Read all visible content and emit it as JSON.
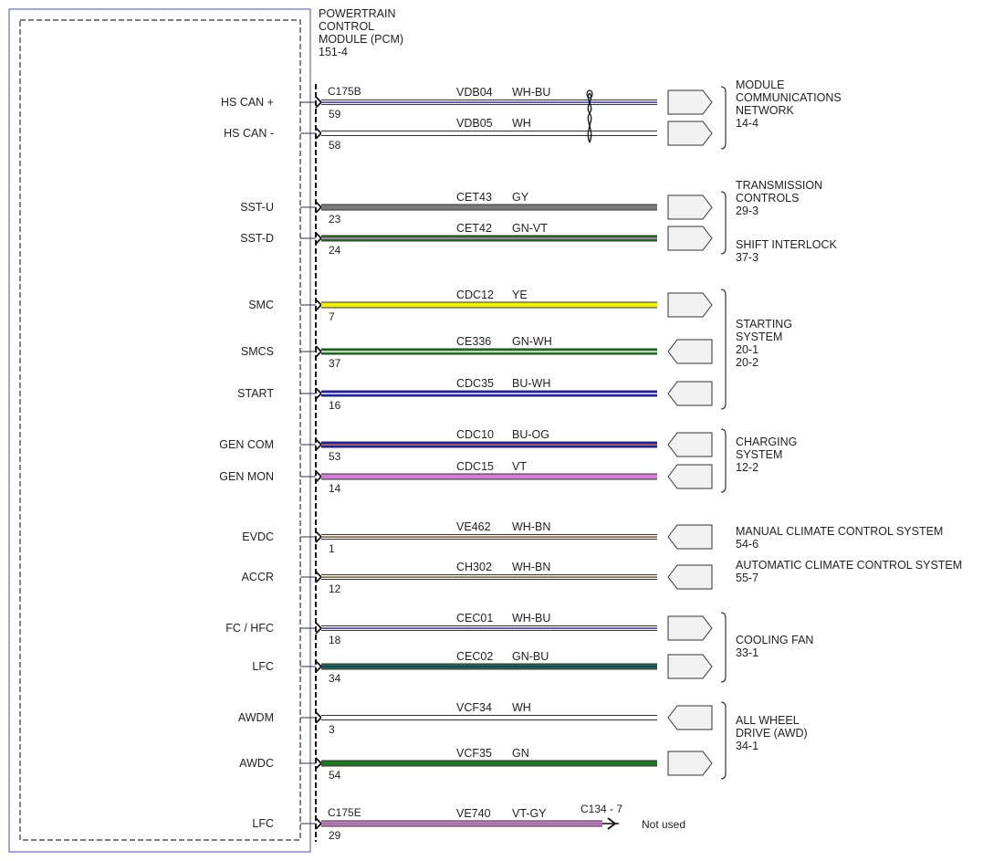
{
  "module": {
    "lines": [
      "POWERTRAIN",
      "CONTROL",
      "MODULE (PCM)",
      "151-4"
    ]
  },
  "colors": {
    "box_border": "#3b4ecf",
    "WH": "#ffffff",
    "BU": "#1a1ad0",
    "GY": "#7a7a7a",
    "GN": "#1f7a1f",
    "VT": "#d77bd7",
    "YE": "#f0f000",
    "BN": "#7a4a1a",
    "OG": "#e08020"
  },
  "rows": [
    {
      "label": "HS CAN +",
      "connector": "C175B",
      "pin": "59",
      "circuit": "VDB04",
      "color_code": "WH-BU",
      "base": "WH",
      "stripe": "BU",
      "dir": "out"
    },
    {
      "label": "HS CAN -",
      "pin": "58",
      "circuit": "VDB05",
      "color_code": "WH",
      "base": "WH",
      "dir": "out"
    },
    {
      "label": "SST-U",
      "pin": "23",
      "circuit": "CET43",
      "color_code": "GY",
      "base": "GY",
      "dir": "out"
    },
    {
      "label": "SST-D",
      "pin": "24",
      "circuit": "CET42",
      "color_code": "GN-VT",
      "base": "GN",
      "stripe": "VT",
      "dir": "out"
    },
    {
      "label": "SMC",
      "pin": "7",
      "circuit": "CDC12",
      "color_code": "YE",
      "base": "YE",
      "dir": "out"
    },
    {
      "label": "SMCS",
      "pin": "37",
      "circuit": "CE336",
      "color_code": "GN-WH",
      "base": "GN",
      "stripe": "WH",
      "dir": "in"
    },
    {
      "label": "START",
      "pin": "16",
      "circuit": "CDC35",
      "color_code": "BU-WH",
      "base": "BU",
      "stripe": "WH",
      "dir": "in"
    },
    {
      "label": "GEN COM",
      "pin": "53",
      "circuit": "CDC10",
      "color_code": "BU-OG",
      "base": "BU",
      "stripe": "OG",
      "dir": "in"
    },
    {
      "label": "GEN MON",
      "pin": "14",
      "circuit": "CDC15",
      "color_code": "VT",
      "base": "VT",
      "dir": "in"
    },
    {
      "label": "EVDC",
      "pin": "1",
      "circuit": "VE462",
      "color_code": "WH-BN",
      "base": "WH",
      "stripe": "BN",
      "dir": "in"
    },
    {
      "label": "ACCR",
      "pin": "12",
      "circuit": "CH302",
      "color_code": "WH-BN",
      "base": "WH",
      "stripe": "BN",
      "dir": "in"
    },
    {
      "label": "FC / HFC",
      "pin": "18",
      "circuit": "CEC01",
      "color_code": "WH-BU",
      "base": "WH",
      "stripe": "BU",
      "dir": "out"
    },
    {
      "label": "LFC",
      "pin": "34",
      "circuit": "CEC02",
      "color_code": "GN-BU",
      "base": "GN",
      "stripe": "BU",
      "dir": "out"
    },
    {
      "label": "AWDM",
      "pin": "3",
      "circuit": "VCF34",
      "color_code": "WH",
      "base": "WH",
      "dir": "in"
    },
    {
      "label": "AWDC",
      "pin": "54",
      "circuit": "VCF35",
      "color_code": "GN",
      "base": "GN",
      "dir": "out"
    },
    {
      "label": "LFC",
      "connector": "C175E",
      "pin": "29",
      "circuit": "VE740",
      "color_code": "VT-GY",
      "base": "VT",
      "stripe": "GY",
      "dir": "none",
      "end_connector": "C134 - 7",
      "end_text": "Not used"
    }
  ],
  "destinations": [
    {
      "lines": [
        "MODULE",
        "COMMUNICATIONS",
        "NETWORK",
        "14-4"
      ],
      "rows": [
        0,
        1
      ]
    },
    {
      "lines": [
        "TRANSMISSION",
        "CONTROLS",
        "29-3"
      ],
      "rows": [
        2,
        3
      ]
    },
    {
      "lines": [
        "SHIFT INTERLOCK",
        "37-3"
      ],
      "rows": [
        3,
        3
      ],
      "nobracket": true
    },
    {
      "lines": [
        "STARTING",
        "SYSTEM",
        "20-1",
        "20-2"
      ],
      "rows": [
        4,
        6
      ]
    },
    {
      "lines": [
        "CHARGING",
        "SYSTEM",
        "12-2"
      ],
      "rows": [
        7,
        8
      ]
    },
    {
      "lines": [
        "MANUAL CLIMATE CONTROL SYSTEM",
        "54-6"
      ],
      "rows": [
        9,
        9
      ],
      "nobracket": true
    },
    {
      "lines": [
        "AUTOMATIC CLIMATE CONTROL SYSTEM",
        "55-7"
      ],
      "rows": [
        10,
        10
      ],
      "nobracket": true
    },
    {
      "lines": [
        "COOLING FAN",
        "33-1"
      ],
      "rows": [
        11,
        12
      ]
    },
    {
      "lines": [
        "ALL WHEEL",
        "DRIVE (AWD)",
        "34-1"
      ],
      "rows": [
        13,
        14
      ]
    }
  ]
}
